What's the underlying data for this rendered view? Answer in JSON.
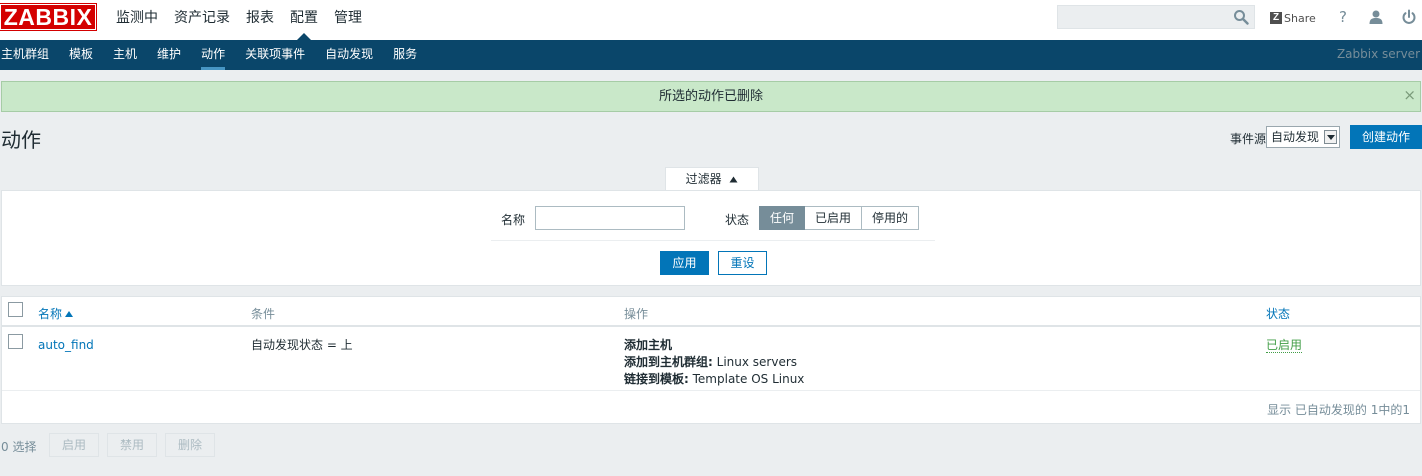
{
  "header": {
    "logo": "ZABBIX",
    "menu": [
      {
        "label": "监测中",
        "active": false
      },
      {
        "label": "资产记录",
        "active": false
      },
      {
        "label": "报表",
        "active": false
      },
      {
        "label": "配置",
        "active": true
      },
      {
        "label": "管理",
        "active": false
      }
    ],
    "search": {
      "value": "",
      "placeholder": ""
    },
    "share_label": "Share",
    "share_logo": "Z",
    "help_label": "?"
  },
  "subnav": {
    "items": [
      "主机群组",
      "模板",
      "主机",
      "维护",
      "动作",
      "关联项事件",
      "自动发现",
      "服务"
    ],
    "active_index": 4,
    "server_name": "Zabbix server"
  },
  "message": {
    "text": "所选的动作已删除",
    "close_symbol": "×"
  },
  "page": {
    "title": "动作",
    "event_source_label": "事件源",
    "event_source_value": "自动发现",
    "create_button": "创建动作"
  },
  "filter": {
    "tab_label": "过滤器",
    "name_label": "名称",
    "name_value": "",
    "status_label": "状态",
    "status_options": [
      "任何",
      "已启用",
      "停用的"
    ],
    "status_selected": 0,
    "apply_label": "应用",
    "reset_label": "重设"
  },
  "table": {
    "columns": {
      "name": "名称",
      "conditions": "条件",
      "operations": "操作",
      "status": "状态"
    },
    "rows": [
      {
        "name": "auto_find",
        "conditions": "自动发现状态 = 上",
        "operations": [
          {
            "label": "添加主机",
            "value": ""
          },
          {
            "label": "添加到主机群组:",
            "value": " Linux servers"
          },
          {
            "label": "链接到模板:",
            "value": " Template OS Linux"
          }
        ],
        "status": "已启用"
      }
    ],
    "footer": "显示 已自动发现的 1中的1"
  },
  "bottom": {
    "selected_count": "0 选择",
    "buttons": [
      "启用",
      "禁用",
      "删除"
    ]
  },
  "colors": {
    "nav_bg": "#0a466a",
    "accent": "#0275b8",
    "success_bg": "#c9e8c9",
    "enabled_green": "#429e47",
    "logo_red": "#d40000"
  }
}
